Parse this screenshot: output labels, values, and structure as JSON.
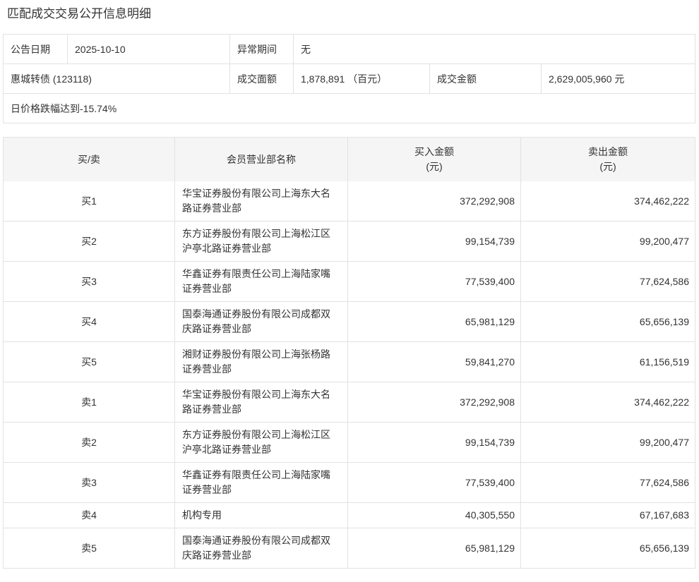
{
  "page": {
    "title": "匹配成交交易公开信息明细"
  },
  "info": {
    "announce_date_label": "公告日期",
    "announce_date": "2025-10-10",
    "abnormal_period_label": "异常期间",
    "abnormal_period": "无",
    "security_name": "惠城转债 (123118)",
    "face_value_label": "成交面额",
    "face_value": "1,878,891 （百元）",
    "amount_label": "成交金额",
    "amount": "2,629,005,960 元",
    "note": "日价格跌幅达到-15.74%"
  },
  "table": {
    "headers": {
      "side": "买/卖",
      "branch": "会员营业部名称",
      "buy": "买入金额",
      "sell": "卖出金额",
      "unit": "(元)"
    },
    "rows": [
      {
        "side": "买1",
        "branch": "华宝证券股份有限公司上海东大名路证券营业部",
        "buy": "372,292,908",
        "sell": "374,462,222"
      },
      {
        "side": "买2",
        "branch": "东方证券股份有限公司上海松江区沪亭北路证券营业部",
        "buy": "99,154,739",
        "sell": "99,200,477"
      },
      {
        "side": "买3",
        "branch": "华鑫证券有限责任公司上海陆家嘴证券营业部",
        "buy": "77,539,400",
        "sell": "77,624,586"
      },
      {
        "side": "买4",
        "branch": "国泰海通证券股份有限公司成都双庆路证券营业部",
        "buy": "65,981,129",
        "sell": "65,656,139"
      },
      {
        "side": "买5",
        "branch": "湘财证券股份有限公司上海张杨路证券营业部",
        "buy": "59,841,270",
        "sell": "61,156,519"
      },
      {
        "side": "卖1",
        "branch": "华宝证券股份有限公司上海东大名路证券营业部",
        "buy": "372,292,908",
        "sell": "374,462,222"
      },
      {
        "side": "卖2",
        "branch": "东方证券股份有限公司上海松江区沪亭北路证券营业部",
        "buy": "99,154,739",
        "sell": "99,200,477"
      },
      {
        "side": "卖3",
        "branch": "华鑫证券有限责任公司上海陆家嘴证券营业部",
        "buy": "77,539,400",
        "sell": "77,624,586"
      },
      {
        "side": "卖4",
        "branch": "机构专用",
        "buy": "40,305,550",
        "sell": "67,167,683"
      },
      {
        "side": "卖5",
        "branch": "国泰海通证券股份有限公司成都双庆路证券营业部",
        "buy": "65,981,129",
        "sell": "65,656,139"
      }
    ]
  },
  "colors": {
    "border": "#e2e2e2",
    "header_bg": "#f5f5f5",
    "text": "#333333"
  }
}
